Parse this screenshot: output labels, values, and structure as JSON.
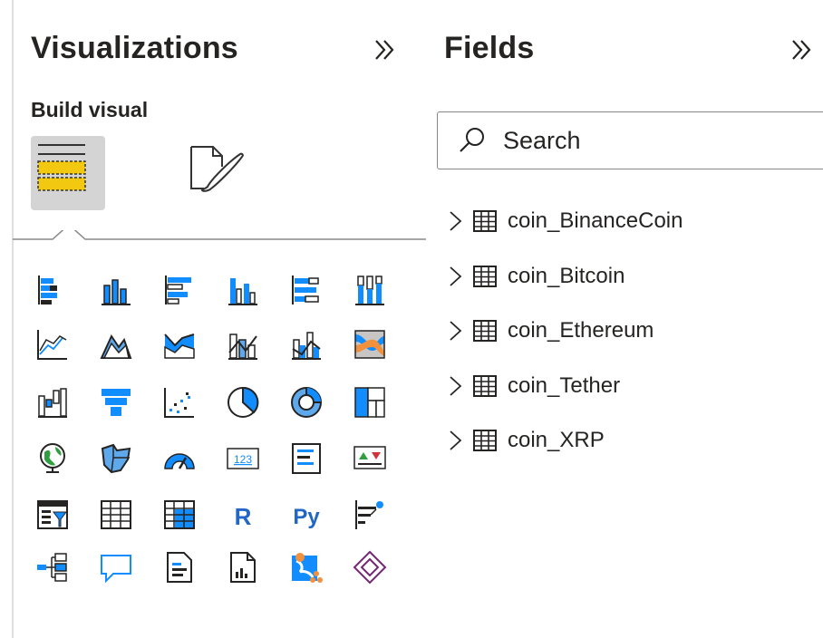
{
  "visualizations": {
    "title": "Visualizations",
    "collapse_icon": "double-chevron-right-icon",
    "subtitle": "Build visual",
    "tabs": [
      {
        "name": "build-visual-tab",
        "icon": "build-visual-icon",
        "selected": true
      },
      {
        "name": "format-visual-tab",
        "icon": "format-visual-icon",
        "selected": false
      }
    ],
    "icons": [
      "stacked-bar-chart-icon",
      "stacked-column-chart-icon",
      "clustered-bar-chart-icon",
      "clustered-column-chart-icon",
      "100-stacked-bar-chart-icon",
      "100-stacked-column-chart-icon",
      "line-chart-icon",
      "area-chart-icon",
      "stacked-area-chart-icon",
      "line-and-stacked-column-chart-icon",
      "line-and-clustered-column-chart-icon",
      "ribbon-chart-icon",
      "waterfall-chart-icon",
      "funnel-icon",
      "scatter-chart-icon",
      "pie-chart-icon",
      "donut-chart-icon",
      "treemap-icon",
      "map-icon",
      "filled-map-icon",
      "gauge-icon",
      "card-icon",
      "multi-row-card-icon",
      "kpi-icon",
      "slicer-icon",
      "table-icon",
      "matrix-icon",
      "r-script-visual-icon",
      "python-visual-icon",
      "key-influencers-icon",
      "decomposition-tree-icon",
      "qa-icon",
      "smart-narrative-icon",
      "paginated-report-icon",
      "azure-map-icon",
      "power-apps-icon"
    ],
    "r_label": "R",
    "py_label": "Py",
    "card_label": "123"
  },
  "fields": {
    "title": "Fields",
    "collapse_icon": "double-chevron-right-icon",
    "search": {
      "placeholder": "Search",
      "value": ""
    },
    "tables": [
      {
        "label": "coin_BinanceCoin"
      },
      {
        "label": "coin_Bitcoin"
      },
      {
        "label": "coin_Ethereum"
      },
      {
        "label": "coin_Tether"
      },
      {
        "label": "coin_XRP"
      }
    ]
  },
  "colors": {
    "accent_blue": "#118dff",
    "light_blue": "#5ea8ec",
    "yellow": "#f2c811",
    "dark": "#252423",
    "gray": "#605e5c"
  }
}
